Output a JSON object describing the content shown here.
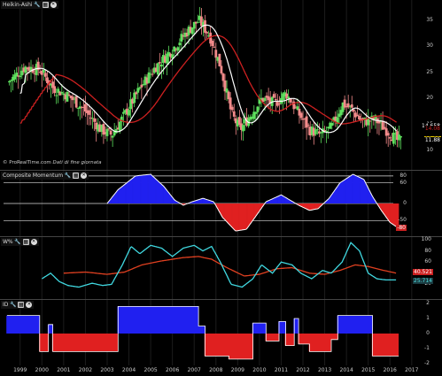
{
  "chart_data": [
    {
      "type": "candlestick",
      "title": "Heikin-Ashi",
      "x": [
        1999,
        2000,
        2001,
        2002,
        2003,
        2004,
        2005,
        2006,
        2007,
        2008,
        2009,
        2010,
        2011,
        2012,
        2013,
        2014,
        2015,
        2016,
        2017
      ],
      "ylim": [
        7,
        38
      ],
      "y_ticks": [
        10,
        15,
        20,
        25,
        30,
        35
      ],
      "overlay_series": [
        {
          "color": "#ffffff"
        },
        {
          "color": "#cc2020"
        }
      ],
      "price_tags": [
        {
          "value": "14.658",
          "color": "#ffffff",
          "bg": "#000000"
        },
        {
          "value": "14.08",
          "color": "#cc2020",
          "bg": "#000000"
        },
        {
          "value": "12.11",
          "color": "#000000",
          "bg": "#f0d000"
        },
        {
          "value": "11.88",
          "color": "#ffffff",
          "bg": "#000000"
        }
      ],
      "up_color": "#5ee05e",
      "down_color": "#f28a8a"
    },
    {
      "type": "area",
      "title": "Composite Momentum",
      "ylim": [
        -90,
        90
      ],
      "levels": [
        80,
        60,
        0,
        -50
      ],
      "level_labels": [
        "80",
        "60",
        "0",
        "-50"
      ],
      "tags": [
        {
          "value": "-80",
          "bg": "#cc2020"
        }
      ],
      "positive_color": "#2020f0",
      "negative_color": "#e02020"
    },
    {
      "type": "line",
      "title": "W%",
      "ylim": [
        0,
        100
      ],
      "y_ticks": [
        100,
        80,
        60,
        40,
        20
      ],
      "tags": [
        {
          "value": "40.521",
          "bg": "#cc2020",
          "color": "#ffffff"
        },
        {
          "value": "25.714",
          "bg": "#1a3a40",
          "color": "#4ee0e0"
        }
      ],
      "series": [
        {
          "color": "#40d8e0"
        },
        {
          "color": "#e04020"
        }
      ]
    },
    {
      "type": "area",
      "title": "ID",
      "ylim": [
        -2,
        2
      ],
      "y_ticks": [
        2,
        1,
        0,
        -1,
        -2
      ],
      "positive_color": "#2020f0",
      "negative_color": "#e02020"
    }
  ],
  "credit": {
    "brand": "© ProRealTime.com",
    "note": "Dati di fine giornata"
  },
  "icons": {
    "wrench": "wrench-icon",
    "settings": "settings-icon",
    "close": "close-icon"
  }
}
